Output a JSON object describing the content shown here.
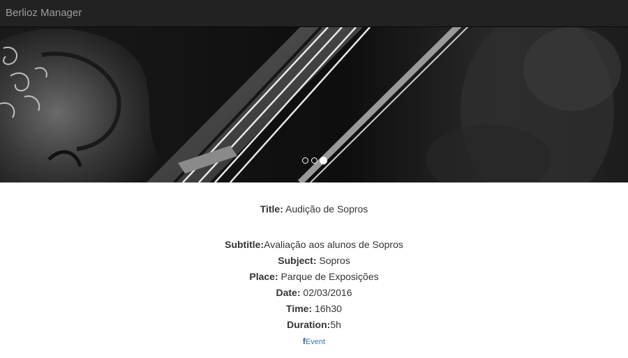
{
  "navbar": {
    "brand": "Berlioz Manager"
  },
  "carousel": {
    "image": "violin-and-bow-photo",
    "slide_count": 3,
    "active_slide": 3
  },
  "event": {
    "title_label": "Title:",
    "title_value": " Audição de Sopros",
    "subtitle_label": "Subtitle:",
    "subtitle_value": "Avaliação aos alunos de Sopros",
    "subject_label": "Subject:",
    "subject_value": " Sopros",
    "place_label": "Place:",
    "place_value": " Parque de Exposições",
    "date_label": "Date:",
    "date_value": " 02/03/2016",
    "time_label": "Time:",
    "time_value": " 16h30",
    "duration_label": "Duration:",
    "duration_value": "5h"
  },
  "facebook": {
    "icon": "facebook-icon",
    "icon_glyph": "f",
    "label": "Event",
    "color": "#3b5998"
  }
}
